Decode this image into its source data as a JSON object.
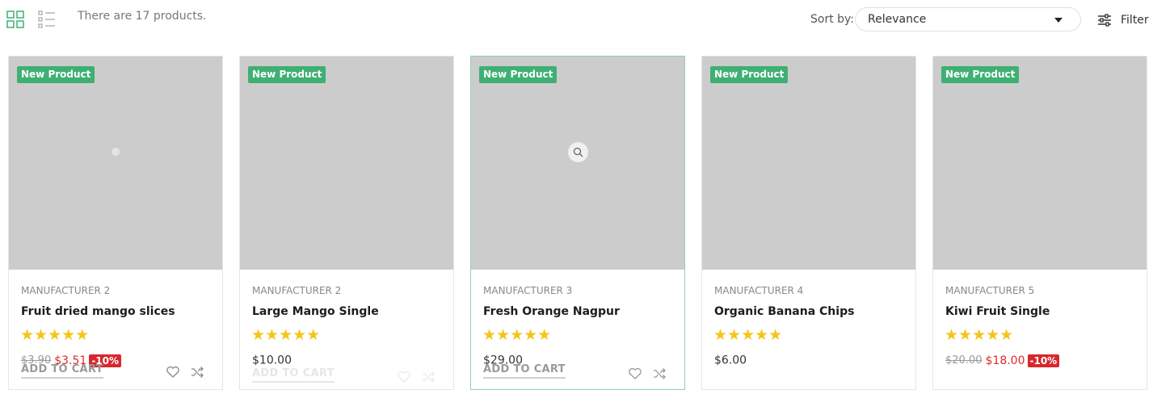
{
  "toolbar": {
    "count_text": "There are 17 products.",
    "sort_label": "Sort by:",
    "sort_value": "Relevance",
    "filter_label": "Filter",
    "accent_color": "#3fb073"
  },
  "products": [
    {
      "badge": "New Product",
      "manufacturer": "MANUFACTURER 2",
      "name": "Fruit dried mango slices",
      "stars": "★★★★★",
      "rating": 5,
      "old_price": "$3.90",
      "price": "$3.51",
      "discount": "-10%",
      "add_to_cart": "ADD TO CART"
    },
    {
      "badge": "New Product",
      "manufacturer": "MANUFACTURER 2",
      "name": "Large Mango Single",
      "stars": "★★★★★",
      "rating": 5,
      "price": "$10.00",
      "add_to_cart": "ADD TO CART"
    },
    {
      "badge": "New Product",
      "manufacturer": "MANUFACTURER 3",
      "name": "Fresh Orange Nagpur",
      "stars": "★★★★★",
      "rating": 5,
      "price": "$29.00",
      "add_to_cart": "ADD TO CART"
    },
    {
      "badge": "New Product",
      "manufacturer": "MANUFACTURER 4",
      "name": "Organic Banana Chips",
      "stars": "★★★★★",
      "rating": 5,
      "price": "$6.00"
    },
    {
      "badge": "New Product",
      "manufacturer": "MANUFACTURER 5",
      "name": "Kiwi Fruit Single",
      "stars": "★★★★★",
      "rating": 5,
      "old_price": "$20.00",
      "price": "$18.00",
      "discount": "-10%"
    }
  ],
  "colors": {
    "badge_bg": "#3fb073",
    "sale_price": "#e02b2b",
    "discount_bg": "#d9272e",
    "star": "#f5c518",
    "placeholder": "#cccccc"
  }
}
